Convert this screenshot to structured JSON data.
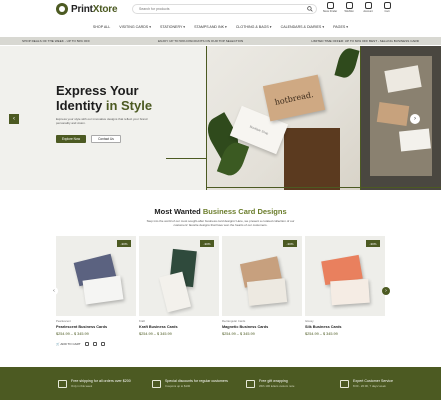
{
  "header": {
    "logo_prefix": "Print",
    "logo_suffix": "Xtore",
    "search_placeholder": "Search for products",
    "icons": [
      {
        "name": "store-locator-icon",
        "label": "Store Finder"
      },
      {
        "name": "wishlist-icon",
        "label": "Wishlist"
      },
      {
        "name": "account-icon",
        "label": "Account"
      },
      {
        "name": "cart-icon",
        "label": "Cart"
      }
    ]
  },
  "nav": {
    "items": [
      "Shop All",
      "Visiting Cards ▾",
      "Stationery ▾",
      "Stamps and Ink ▾",
      "Clothing & Bags ▾",
      "Calendars & Diaries ▾",
      "Pages ▾"
    ]
  },
  "promo": {
    "left": "SHOP DEALS OF THE WEEK - UP TO 50% OFF",
    "center": "ENJOY UP TO 50% DISCOUNTS ON OUR TOP SELECTION",
    "right": "LIMITED TIME OFFER: UP TO 60% OFF BEST - SELLING BUSINESS CARD"
  },
  "hero": {
    "title_line1": "Express Your",
    "title_line2_prefix": "Identity ",
    "title_line2_highlight": "in Style",
    "description": "Express your style with our innovative designs that reflect your brand personality and vision.",
    "primary_button": "Explore Now",
    "secondary_button": "Contact Us",
    "card_brand": "hotbread.",
    "card_white_text": "Boutique Shop"
  },
  "section": {
    "title_prefix": "Most Wanted ",
    "title_highlight": "Business Card Designs",
    "description": "Step into the world of our most sought-after business card designs! Here, we present a curated collection of our customers' favorite designs that have won the hearts of our customers."
  },
  "products": [
    {
      "category": "Pearlescent",
      "name": "Pearlescent Business Cards",
      "price": "$254.99 – $ 345.99",
      "badge": "-30%",
      "card_color": "#5b6280",
      "card2_color": "#f5f5f3"
    },
    {
      "category": "Kraft",
      "name": "Kraft Business Cards",
      "price": "$254.99 – $ 345.99",
      "badge": "-30%",
      "card_color": "#2f4a3c",
      "card2_color": "#f3f1ec"
    },
    {
      "category": "Rectangular Cards",
      "name": "Magnetic Business Cards",
      "price": "$254.99 – $ 345.99",
      "badge": "-30%",
      "card_color": "#c7a07e",
      "card2_color": "#ede9e1"
    },
    {
      "category": "Glossy",
      "name": "Silk Business Cards",
      "price": "$254.99 – $ 345.99",
      "badge": "-30%",
      "card_color": "#e9805e",
      "card2_color": "#f5ece4"
    }
  ],
  "add_to_cart": "ADD TO CART",
  "features": [
    {
      "title": "Free shipping for all orders over $200",
      "sub": "Only in this week"
    },
    {
      "title": "Special discounts for regular customers",
      "sub": "Coupons up to $100"
    },
    {
      "title": "Free gift wrapping",
      "sub": "With 100 letters custom note"
    },
    {
      "title": "Expert Customer Service",
      "sub": "8:00 - 20:00, 7 days/ week"
    }
  ],
  "colors": {
    "accent": "#4c5a22",
    "accent_light": "#6b7d2b",
    "promo_bg": "#d8d8d2",
    "hero_bg": "#f1f1ed"
  }
}
